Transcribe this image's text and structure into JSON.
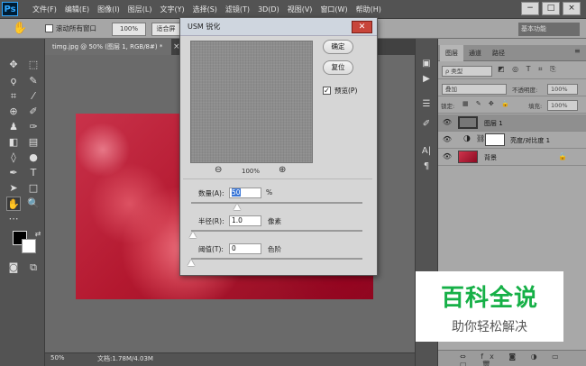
{
  "app": {
    "logo": "Ps"
  },
  "menubar": {
    "items": [
      "文件(F)",
      "编辑(E)",
      "图像(I)",
      "图层(L)",
      "文字(Y)",
      "选择(S)",
      "滤镜(T)",
      "3D(D)",
      "视图(V)",
      "窗口(W)",
      "帮助(H)"
    ]
  },
  "window_controls": {
    "minimize": "−",
    "restore": "□",
    "close": "×"
  },
  "options_bar": {
    "scroll_all_windows": "滚动所有窗口",
    "zoom_value": "100%",
    "fit_screen": "适合屏",
    "workspace": "基本功能"
  },
  "document": {
    "tab_title": "timg.jpg @ 50% (图层 1, RGB/8#) *",
    "tab_close": "×",
    "zoom": "50%",
    "doc_info": "文档:1.78M/4.03M"
  },
  "dialog": {
    "title": "USM 锐化",
    "close": "✕",
    "ok": "确定",
    "reset": "复位",
    "preview_label": "预览(P)",
    "preview_checked": true,
    "preview_zoom": "100%",
    "amount": {
      "label": "数量(A):",
      "value": "50",
      "unit": "%",
      "slider_fraction": 0.27
    },
    "radius": {
      "label": "半径(R):",
      "value": "1.0",
      "unit": "像素",
      "slider_fraction": 0.01
    },
    "threshold": {
      "label": "阈值(T):",
      "value": "0",
      "unit": "色阶",
      "slider_fraction": 0.0
    }
  },
  "layers_panel": {
    "tabs": [
      "图层",
      "通道",
      "路径"
    ],
    "kind_filter": "ρ 类型",
    "blend_mode": "叠加",
    "opacity_label": "不透明度:",
    "opacity_value": "100%",
    "lock_label": "锁定:",
    "fill_label": "填充:",
    "fill_value": "100%",
    "layers": [
      {
        "name": "图层 1",
        "selected": true
      },
      {
        "name": "亮度/对比度 1",
        "selected": false
      },
      {
        "name": "背景",
        "selected": false
      }
    ]
  },
  "watermark": {
    "main": "百科全说",
    "sub": "助你轻松解决"
  }
}
